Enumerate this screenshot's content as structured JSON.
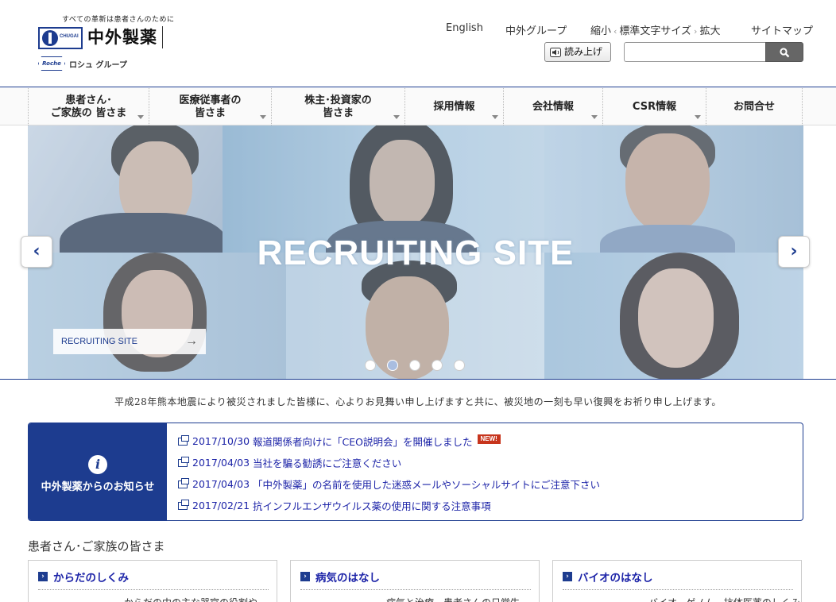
{
  "header": {
    "tagline": "すべての革新は患者さんのために",
    "logo_chugai": "CHUGAI",
    "logo_name": "中外製薬",
    "roche_mark": "Roche",
    "roche_group": "ロシュ グループ",
    "links": {
      "english": "English",
      "group": "中外グループ",
      "shrink": "縮小",
      "standard": "標準文字サイズ",
      "enlarge": "拡大",
      "sitemap": "サイトマップ"
    },
    "read_aloud": "読み上げ",
    "search_placeholder": ""
  },
  "nav": {
    "items": [
      {
        "label": "患者さん･\nご家族の 皆さま"
      },
      {
        "label": "医療従事者の\n皆さま"
      },
      {
        "label": "株主･投資家の\n皆さま"
      },
      {
        "label": "採用情報"
      },
      {
        "label": "会社情報"
      },
      {
        "label": "CSR情報"
      },
      {
        "label": "お問合せ"
      }
    ]
  },
  "hero": {
    "title": "RECRUITING SITE",
    "cta": "RECRUITING SITE",
    "slide_count": 5,
    "active_slide": 2
  },
  "message": "平成28年熊本地震により被災されました皆様に、心よりお見舞い申し上げますと共に、被災地の一刻も早い復興をお祈り申し上げます。",
  "news": {
    "title": "中外製薬からのお知らせ",
    "items": [
      {
        "date": "2017/10/30",
        "text": "報道関係者向けに「CEO説明会」を開催しました",
        "badge": "NEW!"
      },
      {
        "date": "2017/04/03",
        "text": "当社を騙る勧誘にご注意ください"
      },
      {
        "date": "2017/04/03",
        "text": "「中外製薬」の名前を使用した迷惑メールやソーシャルサイトにご注意下さい"
      },
      {
        "date": "2017/02/21",
        "text": "抗インフルエンザウイルス薬の使用に関する注意事項"
      }
    ]
  },
  "patients_section": {
    "title": "患者さん･ご家族の皆さま",
    "cards": [
      {
        "title": "からだのしくみ",
        "teaser": "からだの中の主な器官の役割や"
      },
      {
        "title": "病気のはなし",
        "teaser": "病気と治療、患者さんの日常生"
      },
      {
        "title": "バイオのはなし",
        "teaser": "バイオ、ゲノム、抗体医薬のしくみ"
      }
    ]
  },
  "colors": {
    "brand": "#1d3c8f",
    "link": "#1d24a8",
    "new_badge": "#c7351d"
  }
}
